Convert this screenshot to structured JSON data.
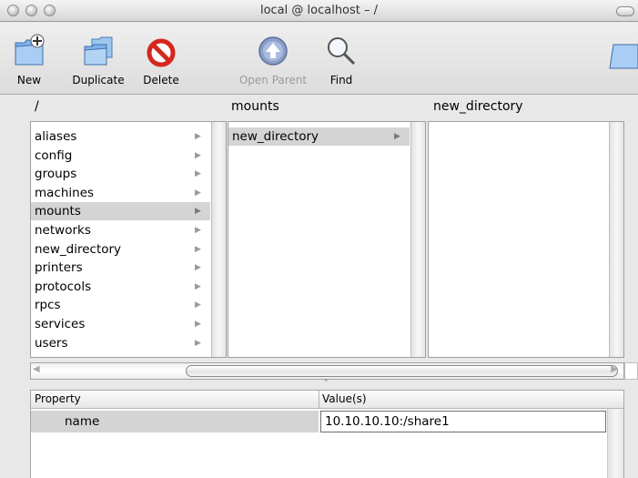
{
  "window": {
    "title": "local @ localhost – /"
  },
  "toolbar": {
    "new_label": "New",
    "duplicate_label": "Duplicate",
    "delete_label": "Delete",
    "open_parent_label": "Open Parent",
    "find_label": "Find"
  },
  "browser": {
    "col1": {
      "header": "/",
      "items": [
        "aliases",
        "config",
        "groups",
        "machines",
        "mounts",
        "networks",
        "new_directory",
        "printers",
        "protocols",
        "rpcs",
        "services",
        "users"
      ],
      "selected": "mounts"
    },
    "col2": {
      "header": "mounts",
      "items": [
        "new_directory"
      ],
      "selected": "new_directory"
    },
    "col3": {
      "header": "new_directory",
      "items": []
    }
  },
  "properties": {
    "col_property": "Property",
    "col_values": "Value(s)",
    "rows": [
      {
        "name": "name",
        "value": "10.10.10.10:/share1"
      }
    ]
  },
  "icons": {
    "arrow": "▶",
    "scroll_left": "◀",
    "scroll_right": "▶",
    "splitter": "ˆ"
  },
  "colors": {
    "selection": "#d4d4d4",
    "delete_red": "#d4281f",
    "folder_blue": "#6fa8e8"
  }
}
